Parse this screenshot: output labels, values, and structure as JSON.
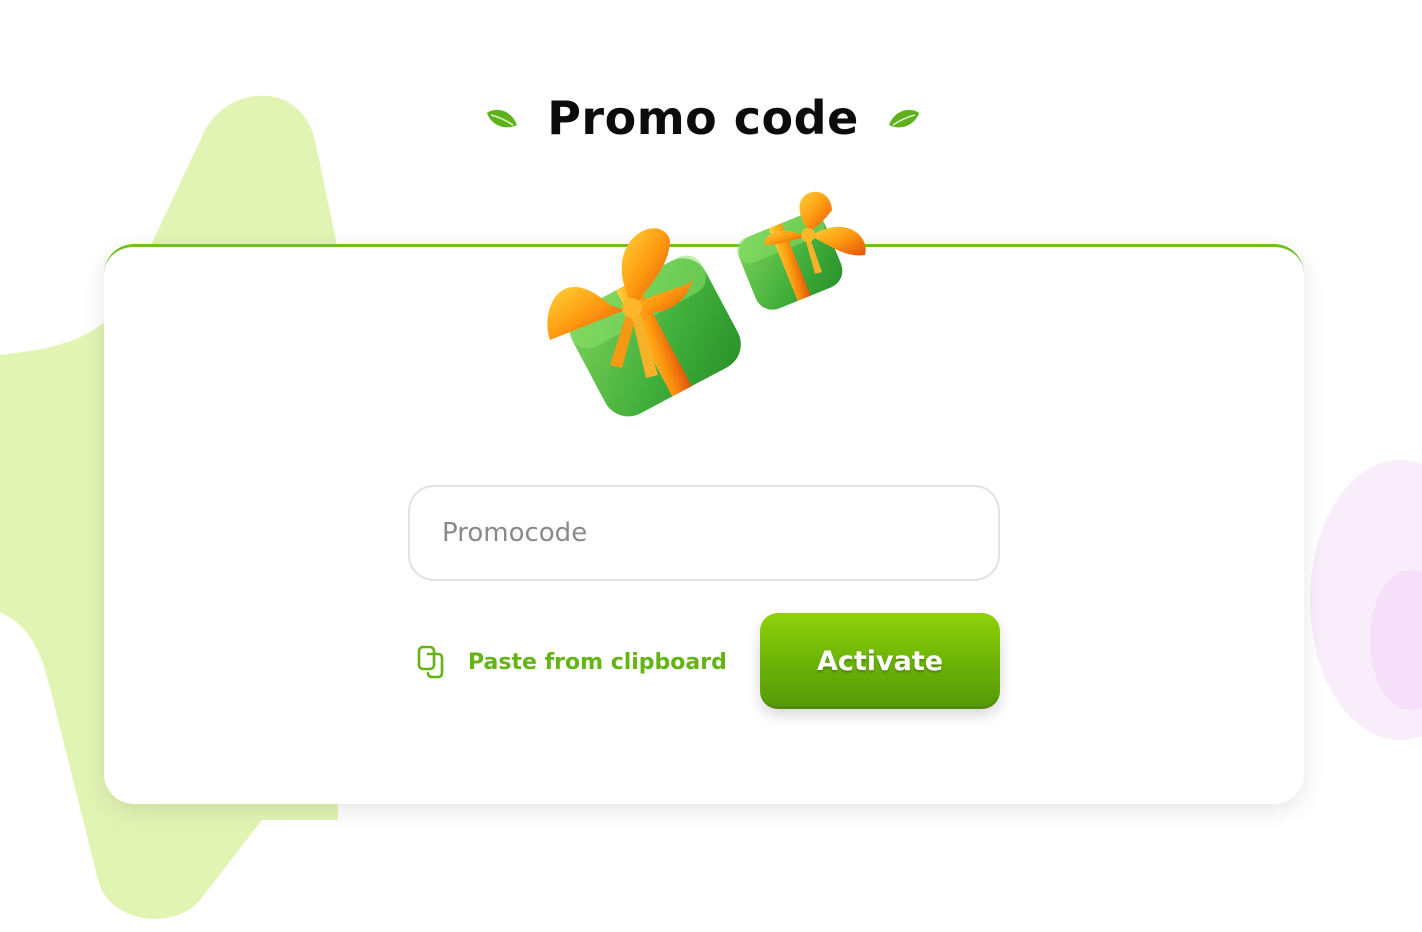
{
  "page": {
    "title": "Promo code"
  },
  "form": {
    "input_placeholder": "Promocode",
    "input_value": "",
    "paste_label": "Paste from clipboard",
    "activate_label": "Activate"
  },
  "icons": {
    "left_leaf": "leaf-icon",
    "right_leaf": "leaf-icon",
    "paste": "clipboard-icon",
    "illustration": "gift-boxes-illustration"
  },
  "colors": {
    "accent": "#64b514",
    "button_top": "#8fd10a",
    "button_bottom": "#56980a",
    "blob": "#e2f4b4",
    "title": "#0c0c0c",
    "placeholder": "#8a8a8a"
  }
}
